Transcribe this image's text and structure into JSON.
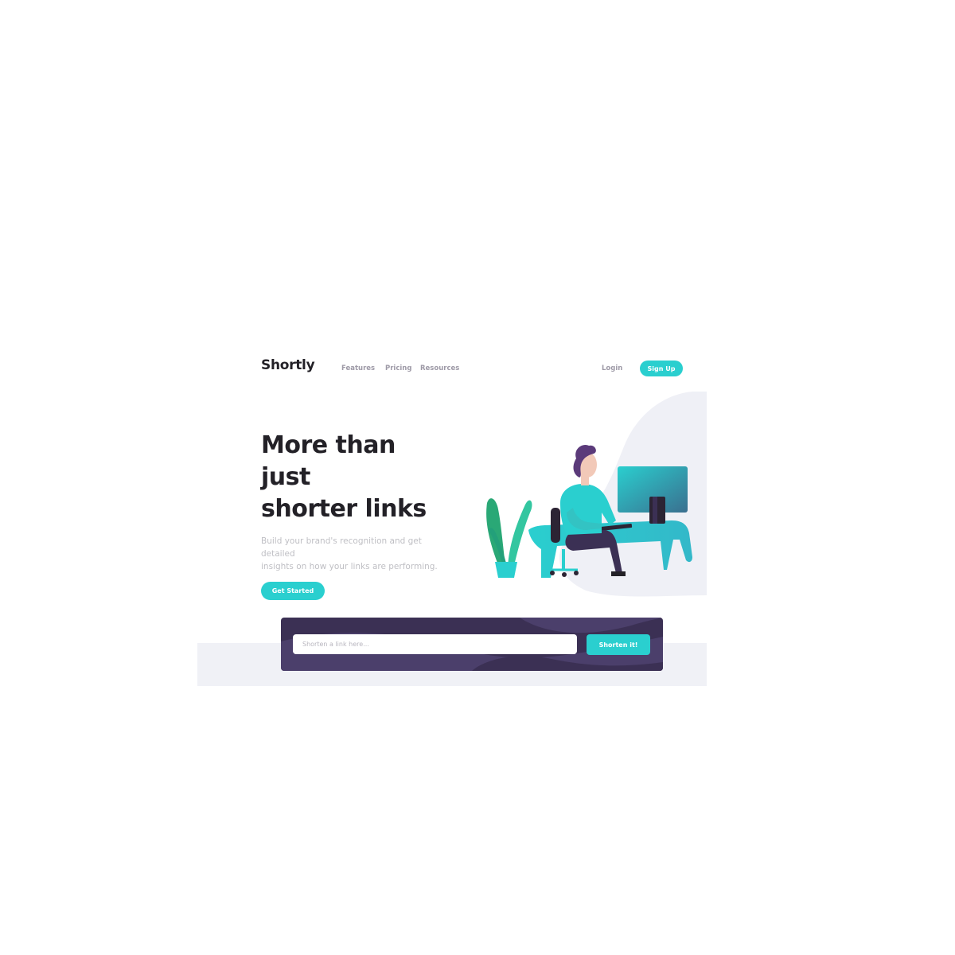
{
  "brand": {
    "name": "Shortly"
  },
  "nav": {
    "links": [
      {
        "label": "Features"
      },
      {
        "label": "Pricing"
      },
      {
        "label": "Resources"
      }
    ],
    "login_label": "Login",
    "signup_label": "Sign Up"
  },
  "hero": {
    "title_lines": [
      "More than",
      "just",
      "shorter links"
    ],
    "subtitle_lines": [
      "Build your brand's recognition and get",
      "detailed",
      "insights on how your links are performing."
    ],
    "cta_label": "Get Started",
    "illustration_icon": "person-working-at-desk-illustration"
  },
  "shorten": {
    "placeholder": "Shorten a link here...",
    "value": "",
    "button_label": "Shorten it!"
  },
  "colors": {
    "accent": "#2acfcf",
    "dark_violet": "#3b3054",
    "heading": "#232127",
    "muted": "#bfbfc4",
    "nav_text": "#9e9aa7",
    "band": "#f0f1f6"
  }
}
